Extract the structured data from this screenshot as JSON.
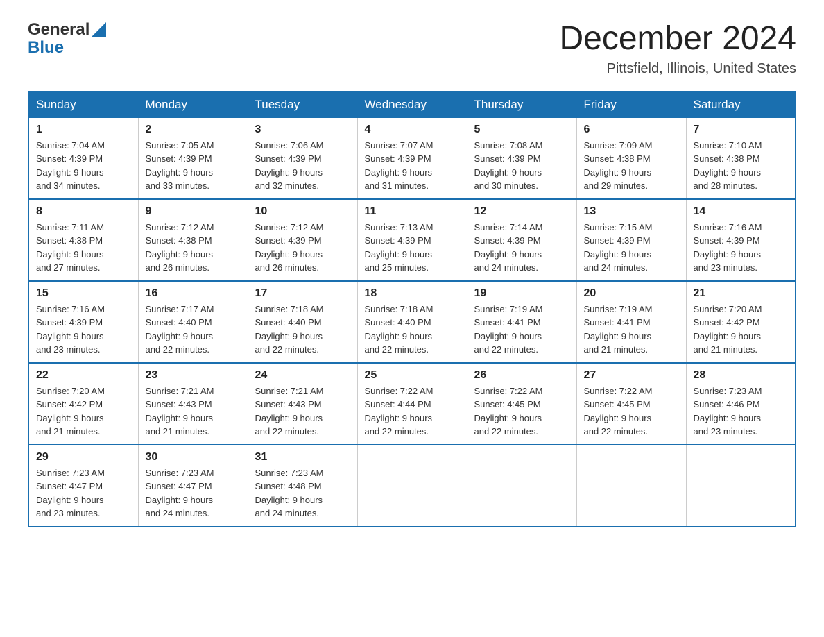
{
  "header": {
    "logo_text_general": "General",
    "logo_text_blue": "Blue",
    "month_year": "December 2024",
    "location": "Pittsfield, Illinois, United States"
  },
  "weekdays": [
    "Sunday",
    "Monday",
    "Tuesday",
    "Wednesday",
    "Thursday",
    "Friday",
    "Saturday"
  ],
  "weeks": [
    [
      {
        "day": "1",
        "sunrise": "Sunrise: 7:04 AM",
        "sunset": "Sunset: 4:39 PM",
        "daylight": "Daylight: 9 hours",
        "daylight2": "and 34 minutes."
      },
      {
        "day": "2",
        "sunrise": "Sunrise: 7:05 AM",
        "sunset": "Sunset: 4:39 PM",
        "daylight": "Daylight: 9 hours",
        "daylight2": "and 33 minutes."
      },
      {
        "day": "3",
        "sunrise": "Sunrise: 7:06 AM",
        "sunset": "Sunset: 4:39 PM",
        "daylight": "Daylight: 9 hours",
        "daylight2": "and 32 minutes."
      },
      {
        "day": "4",
        "sunrise": "Sunrise: 7:07 AM",
        "sunset": "Sunset: 4:39 PM",
        "daylight": "Daylight: 9 hours",
        "daylight2": "and 31 minutes."
      },
      {
        "day": "5",
        "sunrise": "Sunrise: 7:08 AM",
        "sunset": "Sunset: 4:39 PM",
        "daylight": "Daylight: 9 hours",
        "daylight2": "and 30 minutes."
      },
      {
        "day": "6",
        "sunrise": "Sunrise: 7:09 AM",
        "sunset": "Sunset: 4:38 PM",
        "daylight": "Daylight: 9 hours",
        "daylight2": "and 29 minutes."
      },
      {
        "day": "7",
        "sunrise": "Sunrise: 7:10 AM",
        "sunset": "Sunset: 4:38 PM",
        "daylight": "Daylight: 9 hours",
        "daylight2": "and 28 minutes."
      }
    ],
    [
      {
        "day": "8",
        "sunrise": "Sunrise: 7:11 AM",
        "sunset": "Sunset: 4:38 PM",
        "daylight": "Daylight: 9 hours",
        "daylight2": "and 27 minutes."
      },
      {
        "day": "9",
        "sunrise": "Sunrise: 7:12 AM",
        "sunset": "Sunset: 4:38 PM",
        "daylight": "Daylight: 9 hours",
        "daylight2": "and 26 minutes."
      },
      {
        "day": "10",
        "sunrise": "Sunrise: 7:12 AM",
        "sunset": "Sunset: 4:39 PM",
        "daylight": "Daylight: 9 hours",
        "daylight2": "and 26 minutes."
      },
      {
        "day": "11",
        "sunrise": "Sunrise: 7:13 AM",
        "sunset": "Sunset: 4:39 PM",
        "daylight": "Daylight: 9 hours",
        "daylight2": "and 25 minutes."
      },
      {
        "day": "12",
        "sunrise": "Sunrise: 7:14 AM",
        "sunset": "Sunset: 4:39 PM",
        "daylight": "Daylight: 9 hours",
        "daylight2": "and 24 minutes."
      },
      {
        "day": "13",
        "sunrise": "Sunrise: 7:15 AM",
        "sunset": "Sunset: 4:39 PM",
        "daylight": "Daylight: 9 hours",
        "daylight2": "and 24 minutes."
      },
      {
        "day": "14",
        "sunrise": "Sunrise: 7:16 AM",
        "sunset": "Sunset: 4:39 PM",
        "daylight": "Daylight: 9 hours",
        "daylight2": "and 23 minutes."
      }
    ],
    [
      {
        "day": "15",
        "sunrise": "Sunrise: 7:16 AM",
        "sunset": "Sunset: 4:39 PM",
        "daylight": "Daylight: 9 hours",
        "daylight2": "and 23 minutes."
      },
      {
        "day": "16",
        "sunrise": "Sunrise: 7:17 AM",
        "sunset": "Sunset: 4:40 PM",
        "daylight": "Daylight: 9 hours",
        "daylight2": "and 22 minutes."
      },
      {
        "day": "17",
        "sunrise": "Sunrise: 7:18 AM",
        "sunset": "Sunset: 4:40 PM",
        "daylight": "Daylight: 9 hours",
        "daylight2": "and 22 minutes."
      },
      {
        "day": "18",
        "sunrise": "Sunrise: 7:18 AM",
        "sunset": "Sunset: 4:40 PM",
        "daylight": "Daylight: 9 hours",
        "daylight2": "and 22 minutes."
      },
      {
        "day": "19",
        "sunrise": "Sunrise: 7:19 AM",
        "sunset": "Sunset: 4:41 PM",
        "daylight": "Daylight: 9 hours",
        "daylight2": "and 22 minutes."
      },
      {
        "day": "20",
        "sunrise": "Sunrise: 7:19 AM",
        "sunset": "Sunset: 4:41 PM",
        "daylight": "Daylight: 9 hours",
        "daylight2": "and 21 minutes."
      },
      {
        "day": "21",
        "sunrise": "Sunrise: 7:20 AM",
        "sunset": "Sunset: 4:42 PM",
        "daylight": "Daylight: 9 hours",
        "daylight2": "and 21 minutes."
      }
    ],
    [
      {
        "day": "22",
        "sunrise": "Sunrise: 7:20 AM",
        "sunset": "Sunset: 4:42 PM",
        "daylight": "Daylight: 9 hours",
        "daylight2": "and 21 minutes."
      },
      {
        "day": "23",
        "sunrise": "Sunrise: 7:21 AM",
        "sunset": "Sunset: 4:43 PM",
        "daylight": "Daylight: 9 hours",
        "daylight2": "and 21 minutes."
      },
      {
        "day": "24",
        "sunrise": "Sunrise: 7:21 AM",
        "sunset": "Sunset: 4:43 PM",
        "daylight": "Daylight: 9 hours",
        "daylight2": "and 22 minutes."
      },
      {
        "day": "25",
        "sunrise": "Sunrise: 7:22 AM",
        "sunset": "Sunset: 4:44 PM",
        "daylight": "Daylight: 9 hours",
        "daylight2": "and 22 minutes."
      },
      {
        "day": "26",
        "sunrise": "Sunrise: 7:22 AM",
        "sunset": "Sunset: 4:45 PM",
        "daylight": "Daylight: 9 hours",
        "daylight2": "and 22 minutes."
      },
      {
        "day": "27",
        "sunrise": "Sunrise: 7:22 AM",
        "sunset": "Sunset: 4:45 PM",
        "daylight": "Daylight: 9 hours",
        "daylight2": "and 22 minutes."
      },
      {
        "day": "28",
        "sunrise": "Sunrise: 7:23 AM",
        "sunset": "Sunset: 4:46 PM",
        "daylight": "Daylight: 9 hours",
        "daylight2": "and 23 minutes."
      }
    ],
    [
      {
        "day": "29",
        "sunrise": "Sunrise: 7:23 AM",
        "sunset": "Sunset: 4:47 PM",
        "daylight": "Daylight: 9 hours",
        "daylight2": "and 23 minutes."
      },
      {
        "day": "30",
        "sunrise": "Sunrise: 7:23 AM",
        "sunset": "Sunset: 4:47 PM",
        "daylight": "Daylight: 9 hours",
        "daylight2": "and 24 minutes."
      },
      {
        "day": "31",
        "sunrise": "Sunrise: 7:23 AM",
        "sunset": "Sunset: 4:48 PM",
        "daylight": "Daylight: 9 hours",
        "daylight2": "and 24 minutes."
      },
      null,
      null,
      null,
      null
    ]
  ]
}
